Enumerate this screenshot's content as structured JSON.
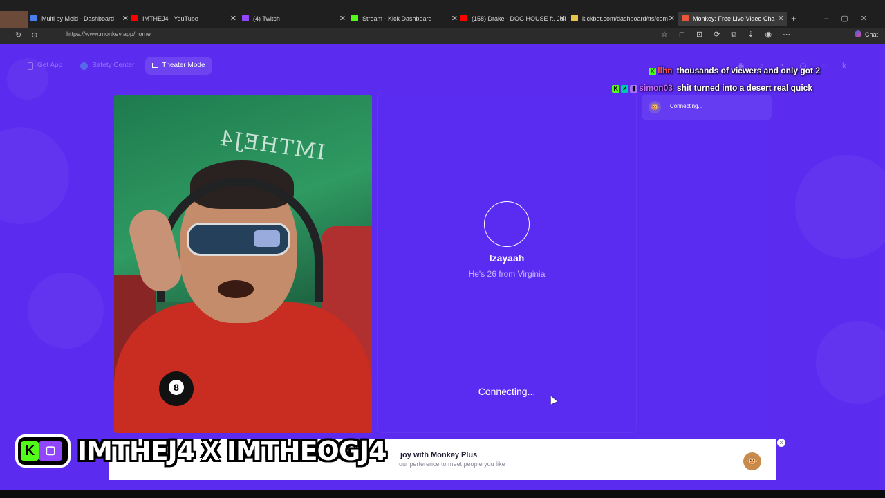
{
  "browser": {
    "tabs": [
      {
        "label": "Multi by Meld - Dashboard",
        "color": "#4a7cf0"
      },
      {
        "label": "IMTHEJ4 - YouTube",
        "color": "#ff0000"
      },
      {
        "label": "(4) Twitch",
        "color": "#9146ff"
      },
      {
        "label": "Stream - Kick Dashboard",
        "color": "#53fc18"
      },
      {
        "label": "(158) Drake - DOG HOUSE ft. Juli",
        "color": "#ff0000"
      },
      {
        "label": "kickbot.com/dashboard/tts/com",
        "color": "#e8c34a"
      },
      {
        "label": "Monkey: Free Live Video Cha",
        "color": "#e9563a"
      }
    ],
    "url": "https://www.monkey.app/home",
    "chat_label": "Chat"
  },
  "nav": {
    "get_app": "Get App",
    "safety_center": "Safety Center",
    "theater_mode": "Theater Mode"
  },
  "overlay_chat": [
    {
      "user": "llhn",
      "message": "thousands of viewers and only got 2"
    },
    {
      "user": "simon03",
      "message": "shit turned into a desert real quick"
    }
  ],
  "match": {
    "name": "Izayaah",
    "description": "He's 26 from Virginia",
    "status": "Connecting..."
  },
  "sidebar": {
    "status": "Connecting..."
  },
  "video": {
    "flag_text": "IMTHEJ4"
  },
  "banner": {
    "title": "joy with Monkey Plus",
    "subtitle": "our perference to meet people you like",
    "close": "×"
  },
  "stream_tag": {
    "left_name": "IMTHEJ4",
    "separator": "X",
    "right_name": "IMTHEOGJ4"
  },
  "colors": {
    "page_bg": "#5b2bf0",
    "accent": "#ffffff"
  }
}
